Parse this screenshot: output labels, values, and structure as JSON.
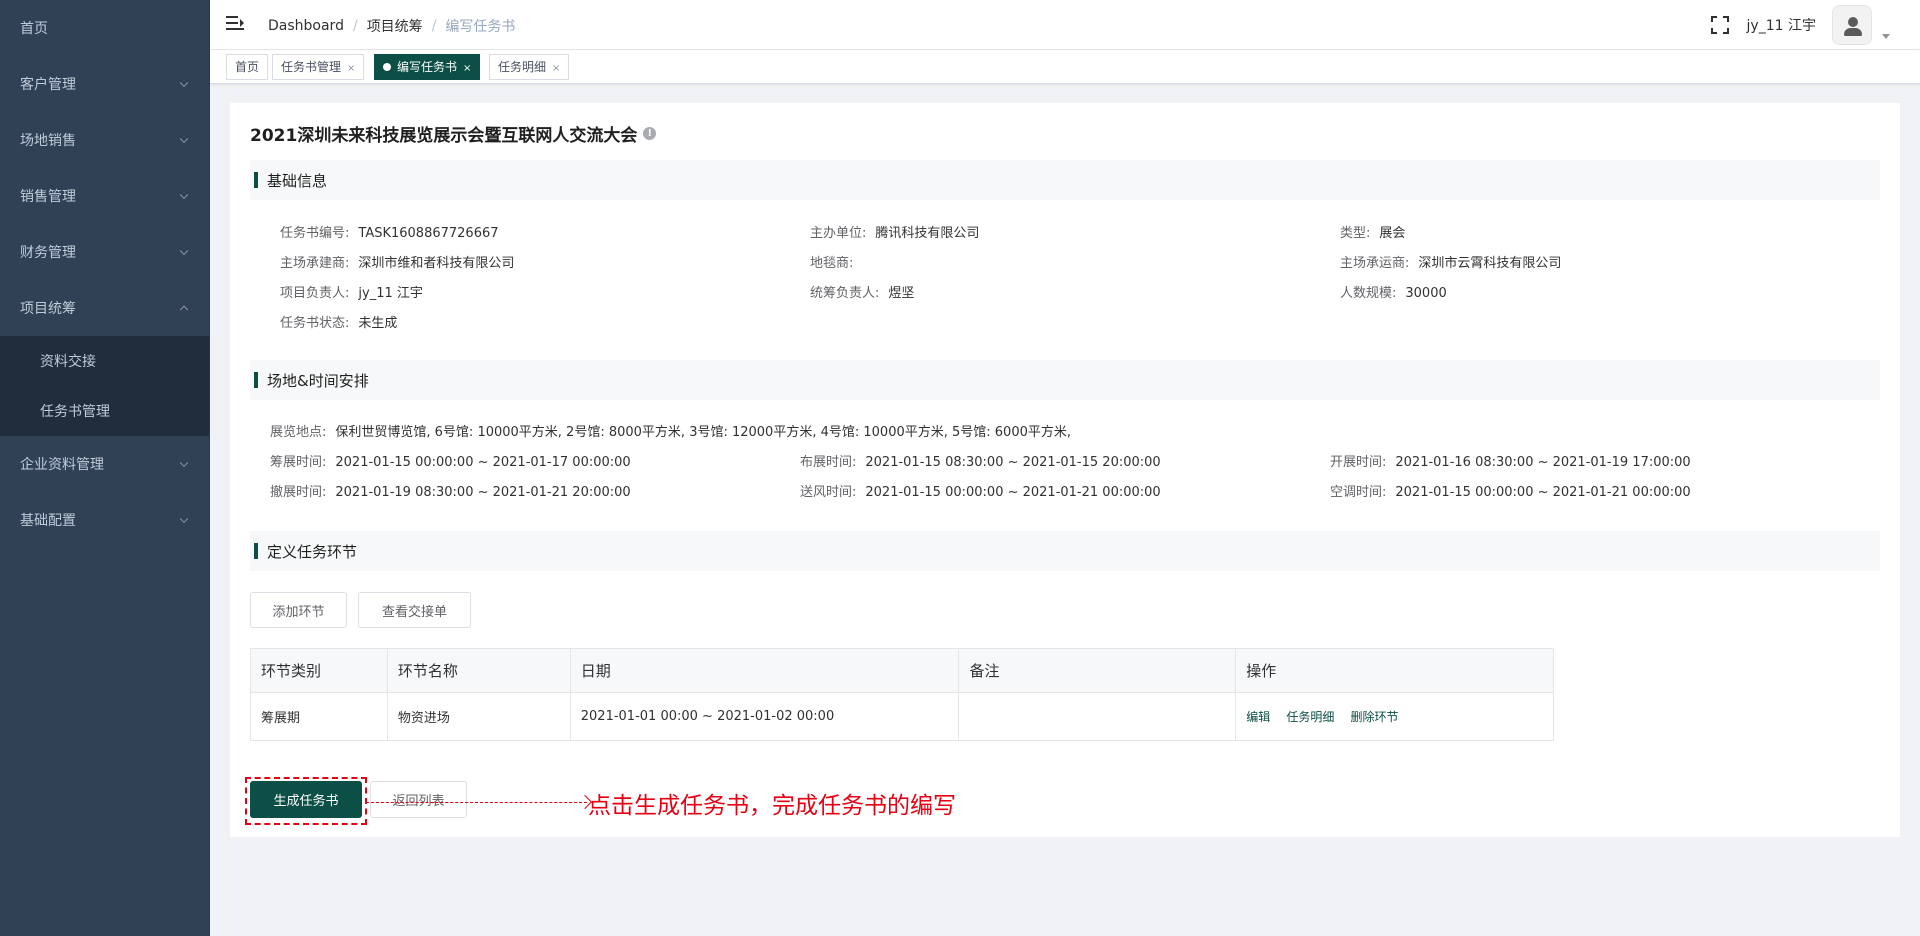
{
  "sidebar": {
    "items": [
      {
        "label": "首页"
      },
      {
        "label": "客户管理"
      },
      {
        "label": "场地销售"
      },
      {
        "label": "销售管理"
      },
      {
        "label": "财务管理"
      },
      {
        "label": "项目统筹"
      },
      {
        "label": "企业资料管理"
      },
      {
        "label": "基础配置"
      }
    ],
    "submenu": [
      {
        "label": "资料交接"
      },
      {
        "label": "任务书管理"
      }
    ]
  },
  "navbar": {
    "breadcrumb": [
      "Dashboard",
      "项目统筹",
      "编写任务书"
    ],
    "username": "jy_11 江宇"
  },
  "tags": [
    {
      "label": "首页"
    },
    {
      "label": "任务书管理"
    },
    {
      "label": "编写任务书"
    },
    {
      "label": "任务明细"
    }
  ],
  "page": {
    "title": "2021深圳未来科技展览展示会暨互联网人交流大会",
    "info_icon": "!"
  },
  "basic": {
    "section_label": "基础信息",
    "fields": [
      {
        "k": "任务书编号:",
        "v": "TASK1608867726667"
      },
      {
        "k": "主办单位:",
        "v": "腾讯科技有限公司"
      },
      {
        "k": "类型:",
        "v": "展会"
      },
      {
        "k": "主场承建商:",
        "v": "深圳市维和者科技有限公司"
      },
      {
        "k": "地毯商:",
        "v": ""
      },
      {
        "k": "主场承运商:",
        "v": "深圳市云霄科技有限公司"
      },
      {
        "k": "项目负责人:",
        "v": "jy_11 江宇"
      },
      {
        "k": "统筹负责人:",
        "v": "煜坚"
      },
      {
        "k": "人数规模:",
        "v": "30000"
      },
      {
        "k": "任务书状态:",
        "v": "未生成"
      }
    ]
  },
  "venue": {
    "section_label": "场地&时间安排",
    "location": {
      "k": "展览地点:",
      "v": "保利世贸博览馆, 6号馆: 10000平方米, 2号馆: 8000平方米, 3号馆: 12000平方米, 4号馆: 10000平方米, 5号馆: 6000平方米,"
    },
    "times": [
      {
        "k": "筹展时间:",
        "v": "2021-01-15 00:00:00 ~ 2021-01-17 00:00:00"
      },
      {
        "k": "布展时间:",
        "v": "2021-01-15 08:30:00 ~ 2021-01-15 20:00:00"
      },
      {
        "k": "开展时间:",
        "v": "2021-01-16 08:30:00 ~ 2021-01-19 17:00:00"
      },
      {
        "k": "撤展时间:",
        "v": "2021-01-19 08:30:00 ~ 2021-01-21 20:00:00"
      },
      {
        "k": "送风时间:",
        "v": "2021-01-15 00:00:00 ~ 2021-01-21 00:00:00"
      },
      {
        "k": "空调时间:",
        "v": "2021-01-15 00:00:00 ~ 2021-01-21 00:00:00"
      }
    ]
  },
  "tasks": {
    "section_label": "定义任务环节",
    "add_button": "添加环节",
    "view_button": "查看交接单",
    "columns": [
      "环节类别",
      "环节名称",
      "日期",
      "备注",
      "操作"
    ],
    "rows": [
      {
        "category": "筹展期",
        "name": "物资进场",
        "date": "2021-01-01 00:00 ~ 2021-01-02 00:00",
        "note": "",
        "actions": [
          "编辑",
          "任务明细",
          "删除环节"
        ]
      }
    ]
  },
  "footer": {
    "generate_button": "生成任务书",
    "back_button": "返回列表"
  },
  "annotation": {
    "text": "点击生成任务书，完成任务书的编写",
    "color": "#e60012"
  },
  "colors": {
    "primary": "#0b4f46",
    "sidebar_bg": "#304156"
  }
}
